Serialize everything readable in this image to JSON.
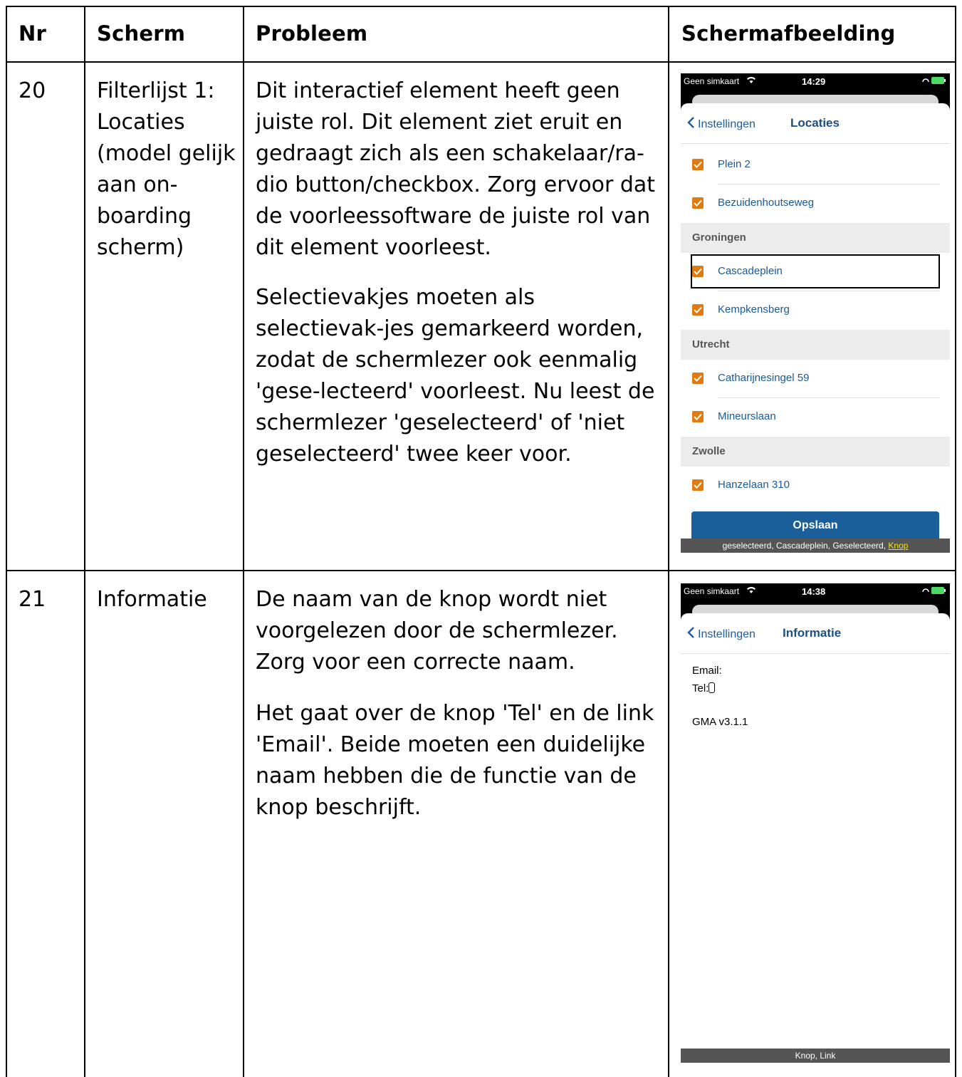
{
  "table": {
    "headers": {
      "nr": "Nr",
      "scherm": "Scherm",
      "probleem": "Probleem",
      "afbeelding": "Schermafbeelding"
    },
    "rows": [
      {
        "nr": "20",
        "scherm": "Filterlijst 1: Locaties (model gelijk aan on-boarding scherm)",
        "probleem_p1": "Dit interactief element heeft geen juiste rol. Dit element ziet eruit en gedraagt zich als een schakelaar/ra-dio button/checkbox. Zorg ervoor dat de voorleessoftware de juiste rol van dit element voorleest.",
        "probleem_p2": "Selectievakjes moeten als selectievak-jes gemarkeerd worden, zodat de schermlezer ook eenmalig 'gese-lecteerd' voorleest. Nu leest de schermlezer 'geselecteerd' of 'niet geselecteerd' twee keer voor."
      },
      {
        "nr": "21",
        "scherm": "Informatie",
        "probleem_p1": "De naam van de knop wordt niet voorgelezen door de schermlezer. Zorg voor een correcte naam.",
        "probleem_p2": "Het gaat over de knop 'Tel' en de link 'Email'. Beide moeten een duidelijke naam hebben die de functie van de knop beschrijft."
      }
    ]
  },
  "screen1": {
    "carrier": "Geen simkaart",
    "time": "14:29",
    "back_label": "Instellingen",
    "title": "Locaties",
    "items": [
      {
        "type": "item",
        "label": "Plein 2",
        "checked": true
      },
      {
        "type": "item",
        "label": "Bezuidenhoutseweg",
        "checked": true
      },
      {
        "type": "section",
        "label": "Groningen"
      },
      {
        "type": "item",
        "label": "Cascadeplein",
        "checked": true,
        "focused": true
      },
      {
        "type": "item",
        "label": "Kempkensberg",
        "checked": true
      },
      {
        "type": "section",
        "label": "Utrecht"
      },
      {
        "type": "item",
        "label": "Catharijnesingel 59",
        "checked": true
      },
      {
        "type": "item",
        "label": "Mineurslaan",
        "checked": true
      },
      {
        "type": "section",
        "label": "Zwolle"
      },
      {
        "type": "item",
        "label": "Hanzelaan 310",
        "checked": true
      }
    ],
    "save_label": "Opslaan",
    "voiceover_text": "geselecteerd, Cascadeplein, Geselecteerd,",
    "voiceover_highlight": "Knop",
    "accent_color": "#e07a12"
  },
  "screen2": {
    "carrier": "Geen simkaart",
    "time": "14:38",
    "back_label": "Instellingen",
    "title": "Informatie",
    "email_label": "Email:",
    "tel_label": "Tel:",
    "version": "GMA v3.1.1",
    "voiceover_text": "Knop, Link"
  }
}
